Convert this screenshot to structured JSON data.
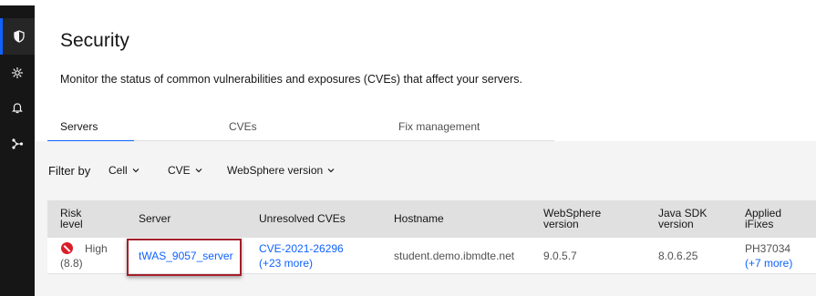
{
  "sidebar": {
    "items": [
      {
        "icon": "shield-icon",
        "active": true
      },
      {
        "icon": "gear-icon",
        "active": false
      },
      {
        "icon": "bell-icon",
        "active": false
      },
      {
        "icon": "network-icon",
        "active": false
      }
    ]
  },
  "page": {
    "title": "Security",
    "description": "Monitor the status of common vulnerabilities and exposures (CVEs) that affect your servers."
  },
  "tabs": [
    {
      "label": "Servers",
      "selected": true
    },
    {
      "label": "CVEs",
      "selected": false
    },
    {
      "label": "Fix management",
      "selected": false
    }
  ],
  "filters": {
    "label": "Filter by",
    "options": [
      "Cell",
      "CVE",
      "WebSphere version"
    ]
  },
  "table": {
    "headers": {
      "risk": [
        "Risk",
        "level"
      ],
      "server": "Server",
      "cves": "Unresolved CVEs",
      "hostname": "Hostname",
      "websphere": [
        "WebSphere",
        "version"
      ],
      "java": [
        "Java SDK",
        "version"
      ],
      "ifixes": [
        "Applied",
        "iFixes"
      ]
    },
    "rows": [
      {
        "risk_level": "High",
        "risk_score": "(8.8)",
        "server": "tWAS_9057_server",
        "cve": "CVE-2021-26296",
        "cve_more": "(+23 more)",
        "hostname": "student.demo.ibmdte.net",
        "websphere_version": "9.0.5.7",
        "java_version": "8.0.6.25",
        "ifix": "PH37034",
        "ifix_more": "(+7 more)"
      }
    ]
  },
  "colors": {
    "accent": "#0f62fe",
    "danger": "#da1e28",
    "highlight": "#a31f2a",
    "sidebar": "#161616"
  }
}
